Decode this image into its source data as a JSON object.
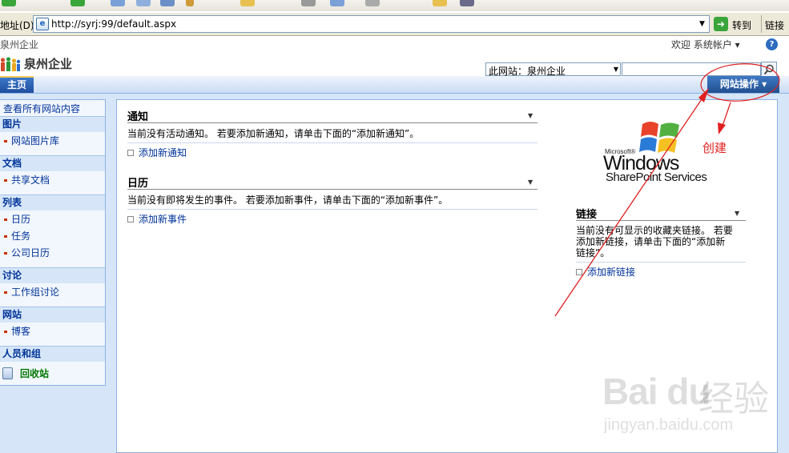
{
  "browser": {
    "address_label": "地址(D)",
    "url": "http://syrj:99/default.aspx",
    "go_label": "转到",
    "links_label": "链接"
  },
  "header": {
    "breadcrumb": "泉州企业",
    "welcome": "欢迎 系统帐户 ▾",
    "site_title": "泉州企业",
    "search_scope": "此网站：泉州企业",
    "search_query": ""
  },
  "topnav": {
    "home_tab": "主页",
    "site_actions": "网站操作 ▾"
  },
  "quicklaunch": {
    "view_all": "查看所有网站内容",
    "sections": [
      {
        "heading": "图片",
        "items": [
          "网站图片库"
        ]
      },
      {
        "heading": "文档",
        "items": [
          "共享文档"
        ]
      },
      {
        "heading": "列表",
        "items": [
          "日历",
          "任务",
          "公司日历"
        ]
      },
      {
        "heading": "讨论",
        "items": [
          "工作组讨论"
        ]
      },
      {
        "heading": "网站",
        "items": [
          "博客"
        ]
      },
      {
        "heading": "人员和组",
        "items": []
      }
    ],
    "recycle_bin": "回收站"
  },
  "webparts": {
    "announcements": {
      "title": "通知",
      "empty_text": "当前没有活动通知。 若要添加新通知，请单击下面的“添加新通知”。",
      "add_link": "添加新通知"
    },
    "calendar": {
      "title": "日历",
      "empty_text": "当前没有即将发生的事件。 若要添加新事件，请单击下面的“添加新事件”。",
      "add_link": "添加新事件"
    },
    "links": {
      "title": "链接",
      "empty_text_line1": "当前没有可显示的收藏夹链接。 若要",
      "empty_text_line2": "添加新链接，请单击下面的“添加新",
      "empty_text_line3": "链接”。",
      "add_link": "添加新链接"
    }
  },
  "logo": {
    "microsoft": "Microsoft®",
    "windows": "Windows",
    "sharepoint": "SharePoint Services"
  },
  "annotation": {
    "label": "创建",
    "color": "#e02020"
  },
  "watermark": {
    "brand": "Bai du",
    "brand_cn": "经验",
    "url": "jingyan.baidu.com"
  }
}
